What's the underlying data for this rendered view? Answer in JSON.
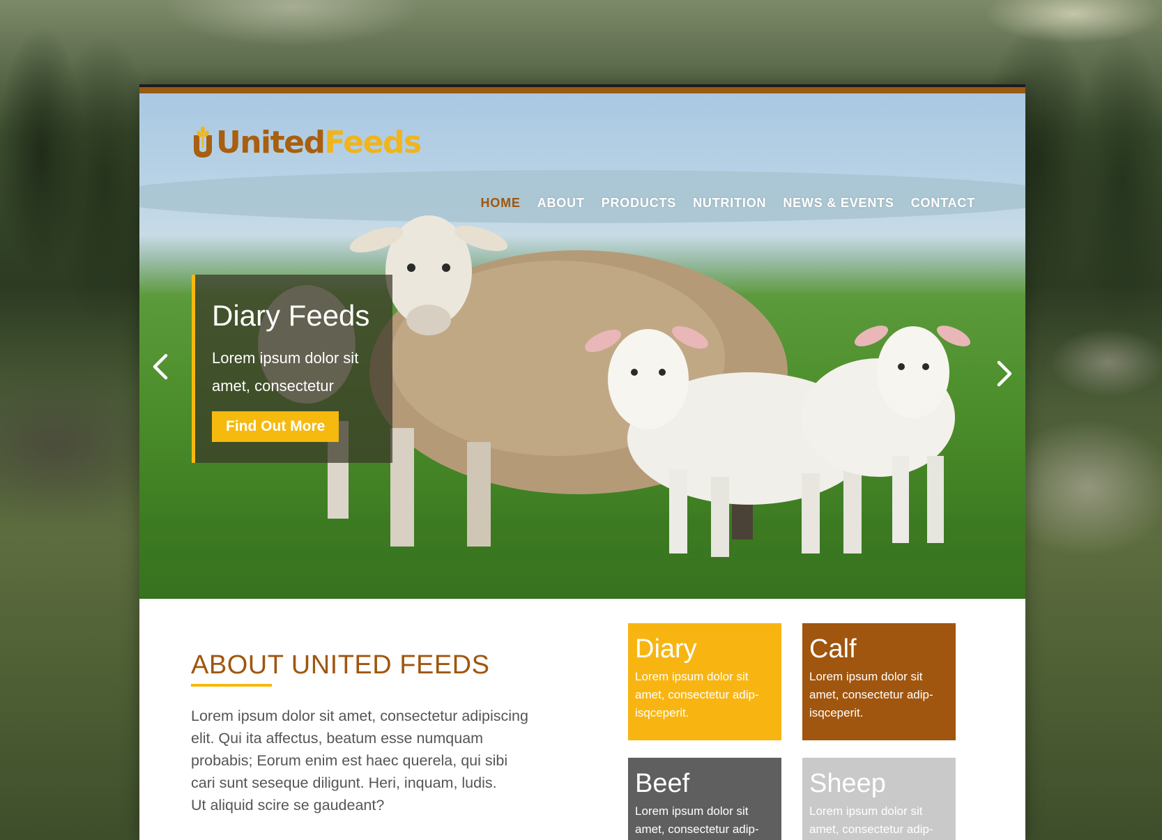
{
  "brand": {
    "name_part1": "United",
    "name_part2": "Feeds",
    "primary_color": "#a0560e",
    "accent_color": "#f6b90e"
  },
  "nav": {
    "items": [
      {
        "label": "HOME",
        "active": true
      },
      {
        "label": "ABOUT",
        "active": false
      },
      {
        "label": "PRODUCTS",
        "active": false
      },
      {
        "label": "NUTRITION",
        "active": false
      },
      {
        "label": "NEWS & EVENTS",
        "active": false
      },
      {
        "label": "CONTACT",
        "active": false
      }
    ]
  },
  "hero": {
    "caption_title": "Diary Feeds",
    "caption_text": "Lorem ipsum dolor sit amet, consectetur",
    "button_label": "Find Out More",
    "prev_icon": "chevron-left-icon",
    "next_icon": "chevron-right-icon"
  },
  "about": {
    "title": "ABOUT UNITED FEEDS",
    "paragraph_lines": [
      "Lorem ipsum dolor sit amet, consectetur adipiscing",
      "elit. Qui ita affectus, beatum esse numquam",
      "probabis; Eorum enim est haec querela, qui sibi",
      "cari sunt seseque diligunt. Heri, inquam, ludis.",
      "Ut aliquid scire se gaudeant?"
    ]
  },
  "categories": [
    {
      "title": "Diary",
      "text": "Lorem ipsum dolor sit amet, consectetur adip-isqceperit.",
      "color": "#f8b512"
    },
    {
      "title": "Calf",
      "text": "Lorem ipsum dolor sit amet, consectetur adip-isqceperit.",
      "color": "#a0560e"
    },
    {
      "title": "Beef",
      "text": "Lorem ipsum dolor sit amet, consectetur adip-",
      "color": "#5f5f5f"
    },
    {
      "title": "Sheep",
      "text": "Lorem ipsum dolor sit amet, consectetur adip-",
      "color": "#c9c9c9"
    }
  ]
}
